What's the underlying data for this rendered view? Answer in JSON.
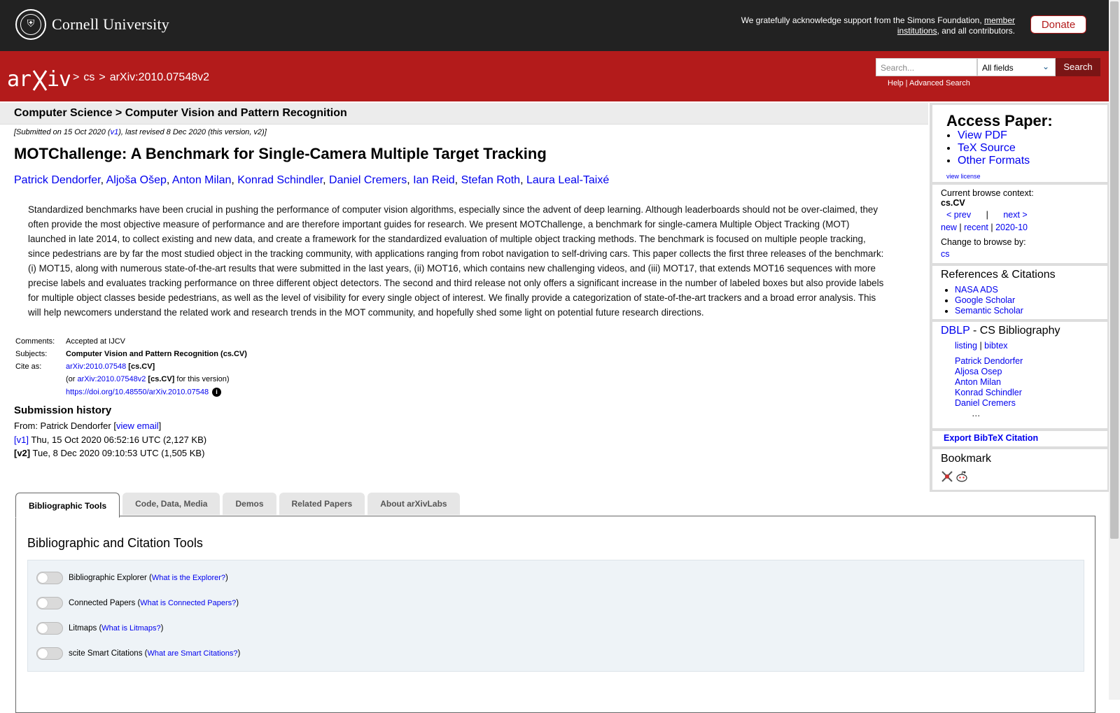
{
  "top": {
    "university": "Cornell University",
    "ack_text_1": "We gratefully acknowledge support from the Simons Foundation, ",
    "ack_link_1": "member institutions",
    "ack_text_2": ", and all contributors.",
    "donate": "Donate"
  },
  "header": {
    "logo_text": "arXiv",
    "breadcrumb": [
      ">",
      "cs",
      ">",
      "arXiv:2010.07548v2"
    ],
    "search_placeholder": "Search...",
    "search_field": "All fields",
    "search_button": "Search",
    "help": "Help",
    "sep": " | ",
    "advanced": "Advanced Search"
  },
  "subheader": "Computer Science > Computer Vision and Pattern Recognition",
  "paper": {
    "date_pre": "[Submitted on 15 Oct 2020 (",
    "date_v1": "v1",
    "date_post": "), last revised 8 Dec 2020 (this version, v2)]",
    "title": "MOTChallenge: A Benchmark for Single-Camera Multiple Target Tracking",
    "authors": [
      "Patrick Dendorfer",
      "Aljoša Ošep",
      "Anton Milan",
      "Konrad Schindler",
      "Daniel Cremers",
      "Ian Reid",
      "Stefan Roth",
      "Laura Leal-Taixé"
    ],
    "abstract": "Standardized benchmarks have been crucial in pushing the performance of computer vision algorithms, especially since the advent of deep learning. Although leaderboards should not be over-claimed, they often provide the most objective measure of performance and are therefore important guides for research. We present MOTChallenge, a benchmark for single-camera Multiple Object Tracking (MOT) launched in late 2014, to collect existing and new data, and create a framework for the standardized evaluation of multiple object tracking methods. The benchmark is focused on multiple people tracking, since pedestrians are by far the most studied object in the tracking community, with applications ranging from robot navigation to self-driving cars. This paper collects the first three releases of the benchmark: (i) MOT15, along with numerous state-of-the-art results that were submitted in the last years, (ii) MOT16, which contains new challenging videos, and (iii) MOT17, that extends MOT16 sequences with more precise labels and evaluates tracking performance on three different object detectors. The second and third release not only offers a significant increase in the number of labeled boxes but also provide labels for multiple object classes beside pedestrians, as well as the level of visibility for every single object of interest. We finally provide a categorization of state-of-the-art trackers and a broad error analysis. This will help newcomers understand the related work and research trends in the MOT community, and hopefully shed some light on potential future research directions.",
    "comments_label": "Comments:",
    "comments": "Accepted at IJCV",
    "subjects_label": "Subjects:",
    "subjects": "Computer Vision and Pattern Recognition (cs.CV)",
    "cite_label": "Cite as:",
    "cite_link": "arXiv:2010.07548",
    "cite_cat": "[cs.CV]",
    "cite2_pre": "(or ",
    "cite2_link": "arXiv:2010.07548v2",
    "cite2_cat": "[cs.CV]",
    "cite2_post": " for this version)",
    "doi": "https://doi.org/10.48550/arXiv.2010.07548",
    "info_glyph": "i"
  },
  "history": {
    "heading": "Submission history",
    "from_pre": "From: Patrick Dendorfer [",
    "from_link": "view email",
    "from_post": "]",
    "v1_label": "[v1]",
    "v1_text": " Thu, 15 Oct 2020 06:52:16 UTC (2,127 KB)",
    "v2_label": "[v2]",
    "v2_text": " Tue, 8 Dec 2020 09:10:53 UTC (1,505 KB)"
  },
  "sidebar": {
    "access_heading": "Access Paper:",
    "access_links": [
      "View PDF",
      "TeX Source",
      "Other Formats"
    ],
    "view_license": "view license",
    "browse_context_label": "Current browse context:",
    "browse_context": "cs.CV",
    "prev": "< prev",
    "pipe": "|",
    "next": "next >",
    "new": "new",
    "recent": "recent",
    "month": "2020-10",
    "change_label": "Change to browse by:",
    "change_cs": "cs",
    "refs_heading": "References & Citations",
    "refs": [
      "NASA ADS",
      "Google Scholar",
      "Semantic Scholar"
    ],
    "dblp": "DBLP",
    "dblp_rest": " - CS Bibliography",
    "listing": "listing",
    "bibtex": "bibtex",
    "dblp_authors": [
      "Patrick Dendorfer",
      "Aljosa Osep",
      "Anton Milan",
      "Konrad Schindler",
      "Daniel Cremers"
    ],
    "ellipsis": "…",
    "export": "Export BibTeX Citation",
    "bookmark": "Bookmark"
  },
  "tabs": [
    "Bibliographic Tools",
    "Code, Data, Media",
    "Demos",
    "Related Papers",
    "About arXivLabs"
  ],
  "tools": {
    "heading": "Bibliographic and Citation Tools",
    "rows": [
      {
        "label": "Bibliographic Explorer (",
        "link": "What is the Explorer?",
        "post": ")"
      },
      {
        "label": "Connected Papers (",
        "link": "What is Connected Papers?",
        "post": ")"
      },
      {
        "label": "Litmaps (",
        "link": "What is Litmaps?",
        "post": ")"
      },
      {
        "label": "scite Smart Citations (",
        "link": "What are Smart Citations?",
        "post": ")"
      }
    ]
  },
  "colors": {
    "arxiv_red": "#b31b1b",
    "top_bar": "#222222",
    "link": "#0000ee"
  }
}
